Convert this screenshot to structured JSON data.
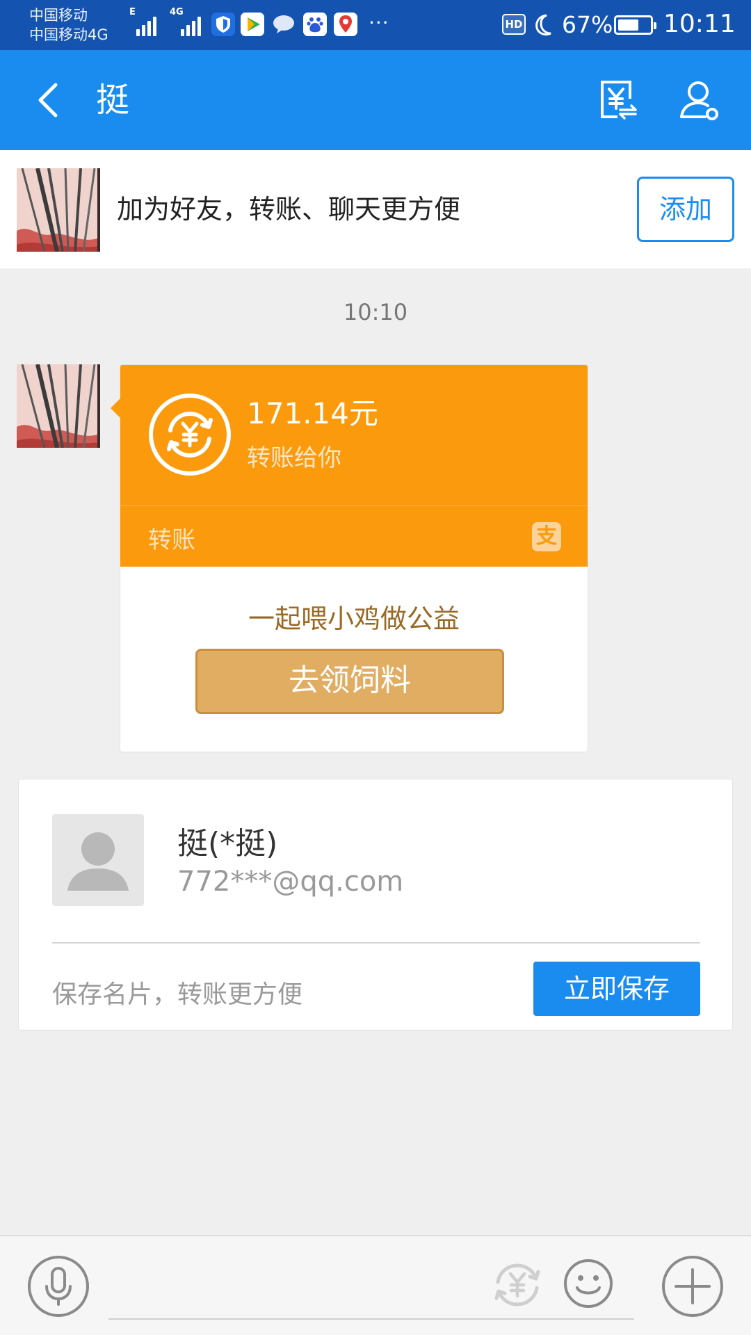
{
  "status_bar": {
    "carrier_1": "中国移动",
    "carrier_2": "中国移动4G",
    "sig1_tag": "E",
    "sig2_tag": "4G",
    "more": "···",
    "hd": "HD",
    "battery_percent": "67%",
    "battery_level": 0.67,
    "time": "10:11"
  },
  "header": {
    "title": "挺",
    "icons": [
      "back-icon",
      "transfer-yuan-icon",
      "user-settings-icon"
    ]
  },
  "banner": {
    "text": "加为好友，转账、聊天更方便",
    "add_button": "添加"
  },
  "chat": {
    "timestamp": "10:10",
    "transfer_card": {
      "amount": "171.14元",
      "subtitle": "转账给你",
      "type_label": "转账",
      "brand_icon": "支",
      "promo_text": "一起喂小鸡做公益",
      "promo_button": "去领饲料",
      "colors": {
        "card": "#fb9a0d",
        "button": "#e0ad62"
      }
    }
  },
  "contact_card": {
    "name": "挺(*挺)",
    "email": "772***@qq.com",
    "hint": "保存名片，转账更方便",
    "save_button": "立即保存"
  },
  "input_bar": {
    "icons": [
      "voice-icon",
      "transfer-yuan-icon",
      "emoji-icon",
      "plus-icon"
    ]
  },
  "colors": {
    "status_bar": "#1454b0",
    "header": "#1a8cf0",
    "accent": "#1a8cf0",
    "background": "#efefef"
  }
}
